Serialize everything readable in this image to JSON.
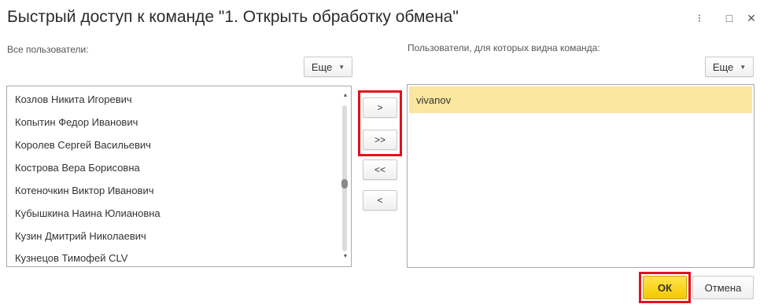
{
  "window": {
    "title": "Быстрый доступ к команде \"1. Открыть обработку обмена\"",
    "menu_icon": "⁝",
    "maximize_icon": "□",
    "close_icon": "✕"
  },
  "left_panel": {
    "label": "Все пользователи:",
    "more_label": "Еще",
    "users": [
      "Козлов Никита Игоревич",
      "Копытин Федор Иванович",
      "Королев Сергей Васильевич",
      "Кострова Вера Борисовна",
      "Котеночкин Виктор Иванович",
      "Кубышкина Наина Юлиановна",
      "Кузин Дмитрий Николаевич",
      "Кузнецов Тимофей CLV"
    ]
  },
  "right_panel": {
    "label": "Пользователи, для которых видна команда:",
    "more_label": "Еще",
    "users": [
      "vivanov"
    ]
  },
  "move_buttons": {
    "add": ">",
    "add_all": ">>",
    "remove_all": "<<",
    "remove": "<"
  },
  "footer": {
    "ok_label": "ОК",
    "cancel_label": "Отмена"
  },
  "colors": {
    "highlight": "#e3121b",
    "selected_row": "#fbe6a0",
    "ok_button": "#f4c900"
  }
}
